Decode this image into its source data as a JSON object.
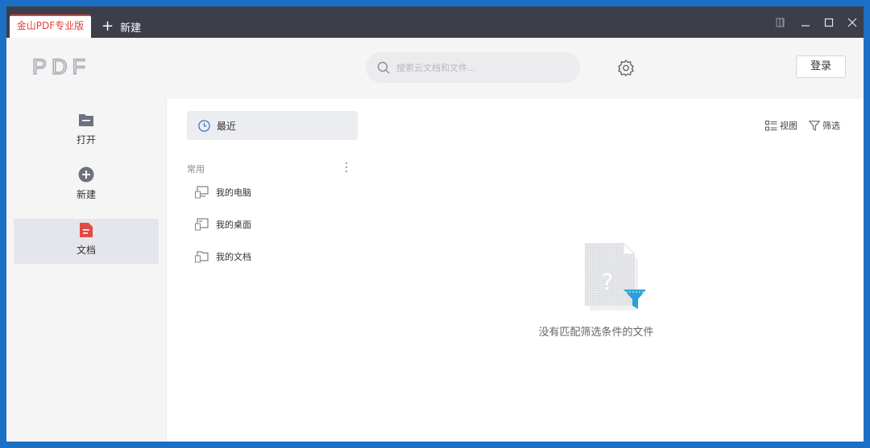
{
  "titlebar": {
    "active_tab": "金山PDF专业版",
    "new_tab_label": "新建",
    "controls": [
      "pin-icon",
      "minimize-icon",
      "maximize-icon",
      "close-icon"
    ]
  },
  "header": {
    "logo": "PDF",
    "search_placeholder": "搜索云文档和文件...",
    "settings_icon": "gear-icon",
    "login_label": "登录"
  },
  "sidebar": {
    "items": [
      {
        "label": "打开",
        "icon": "folder-icon"
      },
      {
        "label": "新建",
        "icon": "plus-circle-icon"
      },
      {
        "label": "文档",
        "icon": "document-icon",
        "active": true
      }
    ]
  },
  "nav": {
    "recent_label": "最近",
    "section_title": "常用",
    "locations": [
      {
        "label": "我的电脑",
        "icon": "computer-icon"
      },
      {
        "label": "我的桌面",
        "icon": "desktop-icon"
      },
      {
        "label": "我的文档",
        "icon": "folder-icon"
      }
    ]
  },
  "toolbar": {
    "view_label": "视图",
    "filter_label": "筛选"
  },
  "main": {
    "empty_text": "没有匹配筛选条件的文件"
  },
  "colors": {
    "accent_red": "#e0403a",
    "titlebar_bg": "#3c3f4a",
    "filter_blue": "#2a9fd8"
  }
}
